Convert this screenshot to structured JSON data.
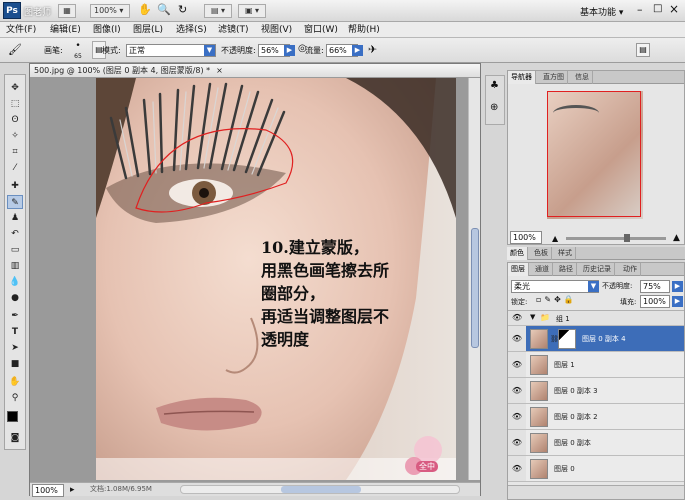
{
  "app": {
    "logo": "Ps",
    "brand_overlay": "图老师",
    "zoom": "100%",
    "workspace": "基本功能"
  },
  "menus": [
    "文件(F)",
    "编辑(E)",
    "图像(I)",
    "图层(L)",
    "选择(S)",
    "滤镜(T)",
    "视图(V)",
    "窗口(W)",
    "帮助(H)"
  ],
  "options": {
    "brush_label": "画笔:",
    "brush_size": "65",
    "mode_label": "模式:",
    "mode_value": "正常",
    "opacity_label": "不透明度:",
    "opacity_value": "56%",
    "flow_label": "流量:",
    "flow_value": "66%"
  },
  "document": {
    "tab_title": "500.jpg @ 100% (图层 0 副本 4, 图层蒙版/8) *",
    "annotation": [
      "10.建立蒙版，",
      "用黑色画笔擦去所",
      "圈部分，",
      "再适当调整图层不",
      "透明度"
    ],
    "status_zoom": "100%",
    "status_doc": "文档:1.08M/6.95M",
    "watermark": "全中"
  },
  "navigator": {
    "tabs": [
      "导航器",
      "直方图",
      "信息"
    ],
    "zoom": "100%"
  },
  "color_tabs": [
    "颜色",
    "色板",
    "样式"
  ],
  "layers_panel": {
    "tabs": [
      "图层",
      "通道",
      "路径",
      "历史记录",
      "动作"
    ],
    "blend_mode": "柔光",
    "opacity_label": "不透明度:",
    "opacity": "75%",
    "lock_label": "锁定:",
    "fill_label": "填充:",
    "fill": "100%",
    "group_name": "组 1",
    "layers": [
      {
        "name": "图层 0 副本 4",
        "selected": true,
        "mask": true
      },
      {
        "name": "图层 1",
        "selected": false,
        "mask": false
      },
      {
        "name": "图层 0 副本 3",
        "selected": false,
        "mask": false
      },
      {
        "name": "图层 0 副本 2",
        "selected": false,
        "mask": false
      },
      {
        "name": "图层 0 副本",
        "selected": false,
        "mask": false
      },
      {
        "name": "图层 0",
        "selected": false,
        "mask": false
      }
    ]
  }
}
